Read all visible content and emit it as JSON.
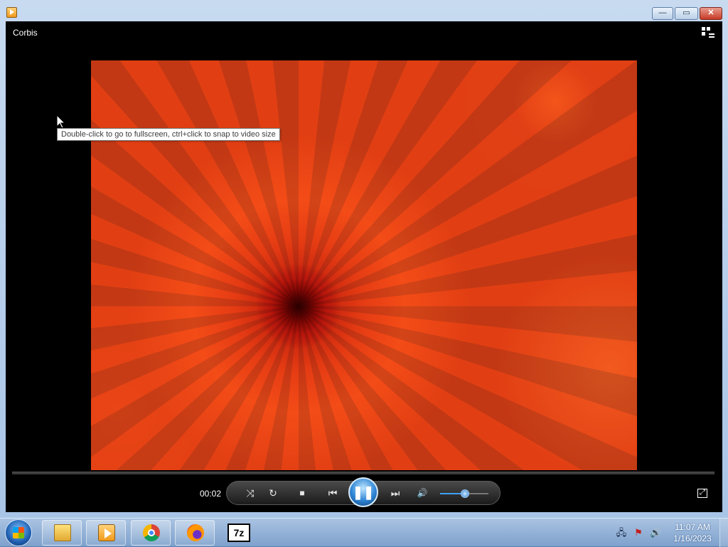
{
  "window": {
    "title": "Corbis",
    "minimize_label": "—",
    "maximize_label": "▭",
    "close_label": "✕"
  },
  "player": {
    "tooltip": "Double-click to go to fullscreen, ctrl+click to snap to video size",
    "elapsed": "00:02",
    "volume_level_percent": 50,
    "icons": {
      "shuffle": "⤨",
      "repeat": "↻",
      "stop": "■",
      "previous": "⏮",
      "play_pause": "❚❚",
      "next": "⏭",
      "volume": "🔊",
      "fullscreen": "⤢"
    }
  },
  "taskbar": {
    "clock_time": "11:07 AM",
    "clock_date": "1/16/2023",
    "sevenzip_label": "7z",
    "tray": {
      "network": "🖧",
      "flag": "⚑",
      "volume": "🔊"
    }
  }
}
